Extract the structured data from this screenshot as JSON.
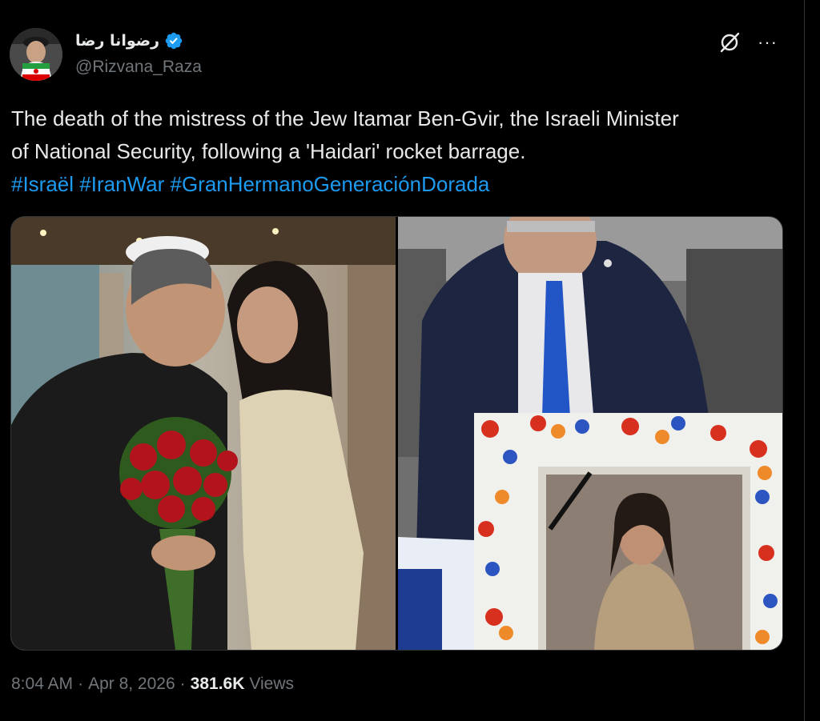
{
  "tweet": {
    "author": {
      "display_name": "رضوانا رضا",
      "handle": "@Rizvana_Raza",
      "verified": true,
      "avatar_icon": "profile-avatar-icon"
    },
    "text_line1": "The death of the mistress of the Jew Itamar Ben-Gvir, the Israeli Minister",
    "text_line2": "of National Security, following a 'Haidari' rocket barrage.",
    "hashtags": [
      "#Israël",
      "#IranWar",
      "#GranHermanoGeneraciónDorada"
    ],
    "media": {
      "left_photo": "photo-couple-with-roses",
      "right_photo": "photo-memorial-portrait"
    },
    "time": "8:04 AM",
    "separator": "·",
    "date": "Apr 8, 2026",
    "views_count": "381.6K",
    "views_label": "Views"
  },
  "icons": {
    "verified": "verified-badge-icon",
    "grok": "grok-icon",
    "more": "more-options-icon"
  },
  "colors": {
    "background": "#000000",
    "text": "#e7e9ea",
    "secondary_text": "#71767b",
    "link": "#1d9bf0",
    "verified": "#1d9bf0"
  }
}
